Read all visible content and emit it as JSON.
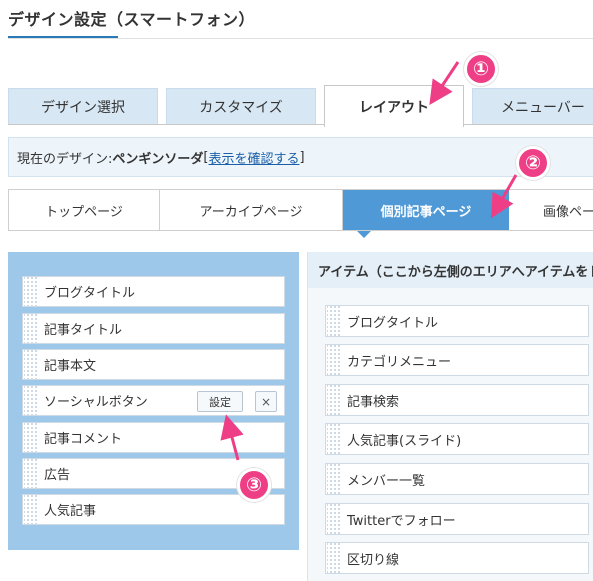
{
  "page": {
    "title": "デザイン設定（スマートフォン）"
  },
  "main_tabs": [
    {
      "label": "デザイン選択",
      "active": false
    },
    {
      "label": "カスタマイズ",
      "active": false
    },
    {
      "label": "レイアウト",
      "active": true
    },
    {
      "label": "メニューバー",
      "active": false
    }
  ],
  "current_design": {
    "prefix": "現在のデザイン: ",
    "name": "ペンギンソーダ",
    "link_open": "[",
    "link_text": "表示を確認する",
    "link_close": "]"
  },
  "sub_tabs": [
    {
      "label": "トップページ",
      "active": false
    },
    {
      "label": "アーカイブページ",
      "active": false
    },
    {
      "label": "個別記事ページ",
      "active": true
    },
    {
      "label": "画像ページ",
      "active": false
    }
  ],
  "layout_slots": [
    {
      "label": "ブログタイトル"
    },
    {
      "label": "記事タイトル"
    },
    {
      "label": "記事本文"
    },
    {
      "label": "ソーシャルボタン",
      "setting_label": "設定",
      "remove_label": "×"
    },
    {
      "label": "記事コメント"
    },
    {
      "label": "広告"
    },
    {
      "label": "人気記事"
    }
  ],
  "items_panel": {
    "header": "アイテム（ここから左側のエリアへアイテムをドラッグ）",
    "items": [
      {
        "label": "ブログタイトル"
      },
      {
        "label": "カテゴリメニュー"
      },
      {
        "label": "記事検索"
      },
      {
        "label": "人気記事(スライド)"
      },
      {
        "label": "メンバー一覧"
      },
      {
        "label": "Twitterでフォロー"
      },
      {
        "label": "区切り線"
      }
    ]
  },
  "annotations": [
    {
      "label": "①"
    },
    {
      "label": "②"
    },
    {
      "label": "③"
    }
  ],
  "colors": {
    "accent": "#4f9ad6",
    "panel": "#9ec8ea",
    "annotation": "#ee3f86"
  }
}
